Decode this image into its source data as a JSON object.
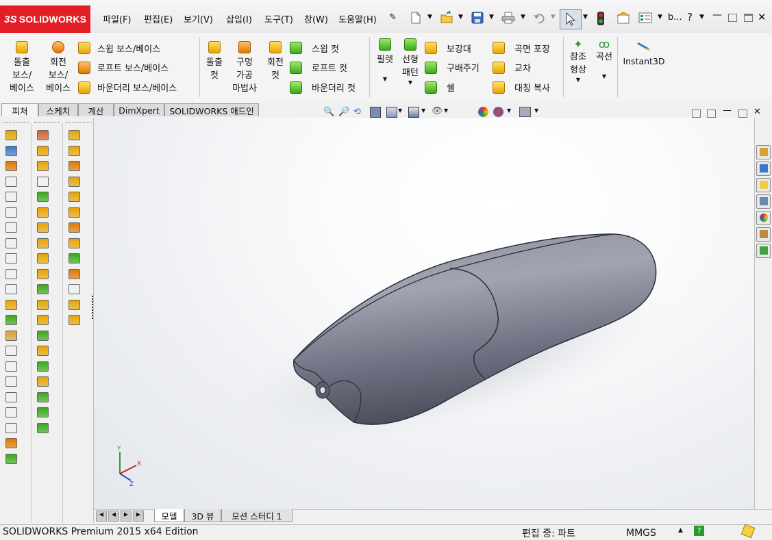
{
  "app": {
    "name": "SOLIDWORKS",
    "logo_mark": "3S"
  },
  "menu": [
    "파일(F)",
    "편집(E)",
    "보기(V)",
    "삽입(I)",
    "도구(T)",
    "창(W)",
    "도움말(H)"
  ],
  "title_short": "b...",
  "help_glyph": "?",
  "ribbon": {
    "extrude_boss": [
      "돌출",
      "보스/",
      "베이스"
    ],
    "revolve_boss": [
      "회전",
      "보스/",
      "베이스"
    ],
    "sweep_boss": "스윕 보스/베이스",
    "loft_boss": "로프트 보스/베이스",
    "boundary_boss": "바운더리 보스/베이스",
    "extrude_cut": [
      "돌출",
      "컷"
    ],
    "hole_wizard": [
      "구멍",
      "가공",
      "마법사"
    ],
    "revolve_cut": [
      "회전",
      "컷"
    ],
    "sweep_cut": "스윕 컷",
    "loft_cut": "로프트 컷",
    "boundary_cut": "바운더리 컷",
    "fillet": "필렛",
    "linear_pattern": [
      "선형",
      "패턴"
    ],
    "rib": "보강대",
    "draft": "구배주기",
    "shell": "쉘",
    "wrap": "곡면 포장",
    "intersect": "교차",
    "mirror": "대칭 복사",
    "ref_geometry": [
      "참조",
      "형상"
    ],
    "curves": "곡선",
    "instant3d": "Instant3D"
  },
  "tabs": [
    "피처",
    "스케치",
    "계산",
    "DimXpert",
    "SOLIDWORKS 애드인"
  ],
  "bottom_tabs": [
    "모델",
    "3D 뷰",
    "모션 스터디 1"
  ],
  "triad": {
    "x": "X",
    "y": "Y",
    "z": "Z"
  },
  "status": {
    "edition": "SOLIDWORKS Premium 2015 x64 Edition",
    "editing": "편집 중: 파트",
    "units": "MMGS"
  }
}
